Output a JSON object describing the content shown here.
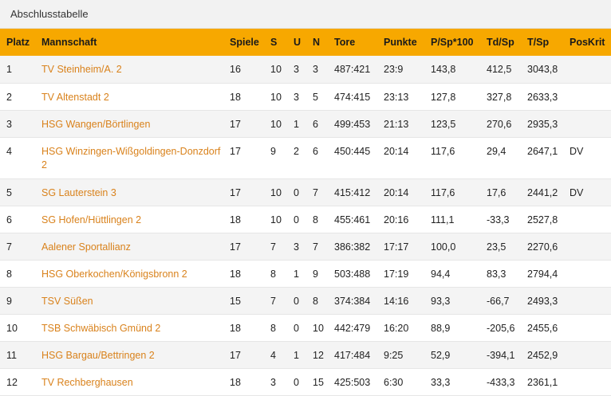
{
  "title": "Abschlusstabelle",
  "columns": [
    "Platz",
    "Mannschaft",
    "Spiele",
    "S",
    "U",
    "N",
    "Tore",
    "Punkte",
    "P/Sp*100",
    "Td/Sp",
    "T/Sp",
    "PosKrit"
  ],
  "rows": [
    [
      "1",
      "TV Steinheim/A. 2",
      "16",
      "10",
      "3",
      "3",
      "487:421",
      "23:9",
      "143,8",
      "412,5",
      "3043,8",
      ""
    ],
    [
      "2",
      "TV Altenstadt 2",
      "18",
      "10",
      "3",
      "5",
      "474:415",
      "23:13",
      "127,8",
      "327,8",
      "2633,3",
      ""
    ],
    [
      "3",
      "HSG Wangen/Börtlingen",
      "17",
      "10",
      "1",
      "6",
      "499:453",
      "21:13",
      "123,5",
      "270,6",
      "2935,3",
      ""
    ],
    [
      "4",
      "HSG Winzingen-Wißgoldingen-Donzdorf 2",
      "17",
      "9",
      "2",
      "6",
      "450:445",
      "20:14",
      "117,6",
      "29,4",
      "2647,1",
      "DV"
    ],
    [
      "5",
      "SG Lauterstein 3",
      "17",
      "10",
      "0",
      "7",
      "415:412",
      "20:14",
      "117,6",
      "17,6",
      "2441,2",
      "DV"
    ],
    [
      "6",
      "SG Hofen/Hüttlingen 2",
      "18",
      "10",
      "0",
      "8",
      "455:461",
      "20:16",
      "111,1",
      "-33,3",
      "2527,8",
      ""
    ],
    [
      "7",
      "Aalener Sportallianz",
      "17",
      "7",
      "3",
      "7",
      "386:382",
      "17:17",
      "100,0",
      "23,5",
      "2270,6",
      ""
    ],
    [
      "8",
      "HSG Oberkochen/Königsbronn 2",
      "18",
      "8",
      "1",
      "9",
      "503:488",
      "17:19",
      "94,4",
      "83,3",
      "2794,4",
      ""
    ],
    [
      "9",
      "TSV Süßen",
      "15",
      "7",
      "0",
      "8",
      "374:384",
      "14:16",
      "93,3",
      "-66,7",
      "2493,3",
      ""
    ],
    [
      "10",
      "TSB Schwäbisch Gmünd 2",
      "18",
      "8",
      "0",
      "10",
      "442:479",
      "16:20",
      "88,9",
      "-205,6",
      "2455,6",
      ""
    ],
    [
      "11",
      "HSG Bargau/Bettringen 2",
      "17",
      "4",
      "1",
      "12",
      "417:484",
      "9:25",
      "52,9",
      "-394,1",
      "2452,9",
      ""
    ],
    [
      "12",
      "TV Rechberghausen",
      "18",
      "3",
      "0",
      "15",
      "425:503",
      "6:30",
      "33,3",
      "-433,3",
      "2361,1",
      ""
    ]
  ],
  "colors": {
    "header_bg": "#f7a800",
    "team_link": "#d9821c",
    "row_alt": "#f4f4f4"
  }
}
